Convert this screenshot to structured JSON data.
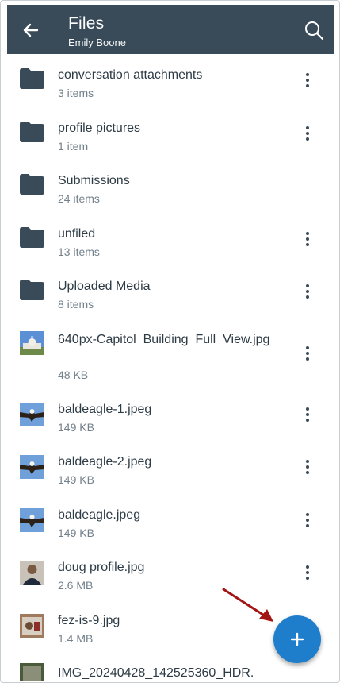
{
  "header": {
    "title": "Files",
    "subtitle": "Emily Boone",
    "back_icon": "arrow-left-icon",
    "search_icon": "search-icon"
  },
  "colors": {
    "header_bg": "#394b58",
    "fab_bg": "#1f7ecb",
    "folder": "#394b58",
    "annotation_arrow": "#a31515"
  },
  "items": [
    {
      "name": "conversation attachments",
      "meta": "3 items",
      "kind": "folder",
      "has_menu": true
    },
    {
      "name": "profile pictures",
      "meta": "1 item",
      "kind": "folder",
      "has_menu": true
    },
    {
      "name": "Submissions",
      "meta": "24 items",
      "kind": "folder",
      "has_menu": false
    },
    {
      "name": "unfiled",
      "meta": "13 items",
      "kind": "folder",
      "has_menu": true
    },
    {
      "name": "Uploaded Media",
      "meta": "8 items",
      "kind": "folder",
      "has_menu": true
    },
    {
      "name": "640px-Capitol_Building_Full_View.jpg",
      "meta": "48 KB",
      "kind": "image",
      "has_menu": true
    },
    {
      "name": "baldeagle-1.jpeg",
      "meta": "149 KB",
      "kind": "image",
      "has_menu": true
    },
    {
      "name": "baldeagle-2.jpeg",
      "meta": "149 KB",
      "kind": "image",
      "has_menu": true
    },
    {
      "name": "baldeagle.jpeg",
      "meta": "149 KB",
      "kind": "image",
      "has_menu": true
    },
    {
      "name": "doug profile.jpg",
      "meta": "2.6 MB",
      "kind": "image",
      "has_menu": true
    },
    {
      "name": "fez-is-9.jpg",
      "meta": "1.4 MB",
      "kind": "image",
      "has_menu": false
    },
    {
      "name": "IMG_20240428_142525360_HDR.",
      "meta": "",
      "kind": "image",
      "has_menu": false
    }
  ],
  "fab": {
    "icon": "plus-icon"
  }
}
